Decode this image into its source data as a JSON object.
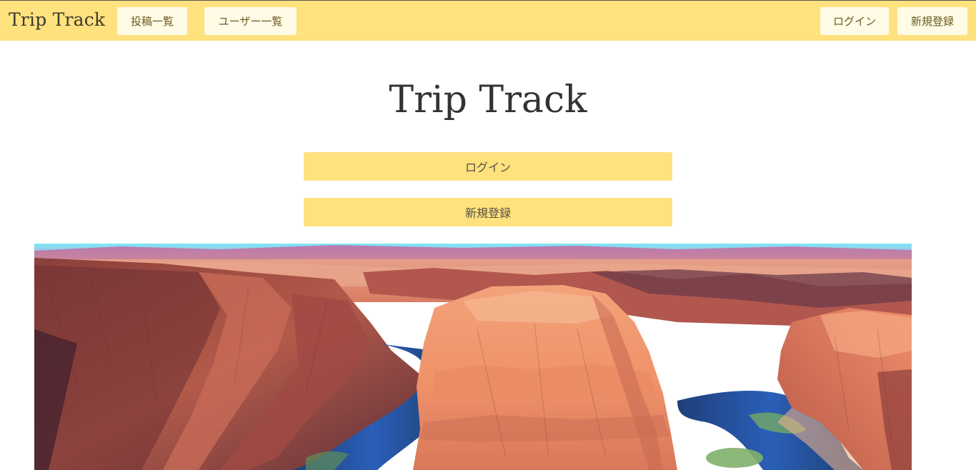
{
  "navbar": {
    "brand": "Trip Track",
    "links": {
      "posts": "投稿一覧",
      "users": "ユーザー一覧"
    },
    "auth": {
      "login": "ログイン",
      "signup": "新規登録"
    },
    "background_color": "#ffe17d"
  },
  "hero": {
    "title": "Trip Track",
    "login_button": "ログイン",
    "signup_button": "新規登録",
    "accent_color": "#ffe17d"
  },
  "hero_image": {
    "subject": "canyon with river bend"
  }
}
